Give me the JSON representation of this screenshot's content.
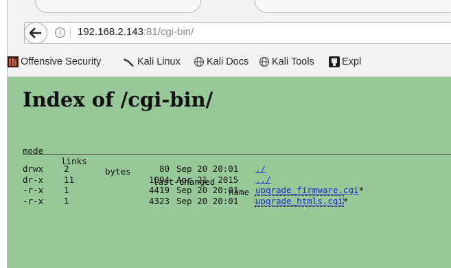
{
  "browser": {
    "url_host": "192.168.2.143",
    "url_rest": ":81/cgi-bin/",
    "bookmarks": [
      {
        "label": "Offensive Security",
        "icon": "offsec-icon"
      },
      {
        "label": "Kali Linux",
        "icon": "kali-dragon-icon"
      },
      {
        "label": "Kali Docs",
        "icon": "globe-icon"
      },
      {
        "label": "Kali Tools",
        "icon": "globe-icon"
      },
      {
        "label": "Expl",
        "icon": "exploit-db-icon"
      }
    ]
  },
  "page": {
    "title": "Index of /cgi-bin/",
    "columns": [
      "mode",
      "links",
      "bytes",
      "last-changed",
      "name"
    ],
    "rows": [
      {
        "mode": "drwx",
        "links": "2",
        "bytes": "80",
        "date": "Sep 20 20:01",
        "name": "./",
        "suffix": ""
      },
      {
        "mode": "dr-x",
        "links": "11",
        "bytes": "1094",
        "date": "Apr 21  2015",
        "name": "../",
        "suffix": ""
      },
      {
        "mode": "-r-x",
        "links": "1",
        "bytes": "4419",
        "date": "Sep 20 20:01",
        "name": "upgrade_firmware.cgi",
        "suffix": "*"
      },
      {
        "mode": "-r-x",
        "links": "1",
        "bytes": "4323",
        "date": "Sep 20 20:01",
        "name": "upgrade_htmls.cgi",
        "suffix": "*"
      }
    ]
  },
  "colors": {
    "page_background": "#96c898",
    "link": "#1a2bd6"
  }
}
